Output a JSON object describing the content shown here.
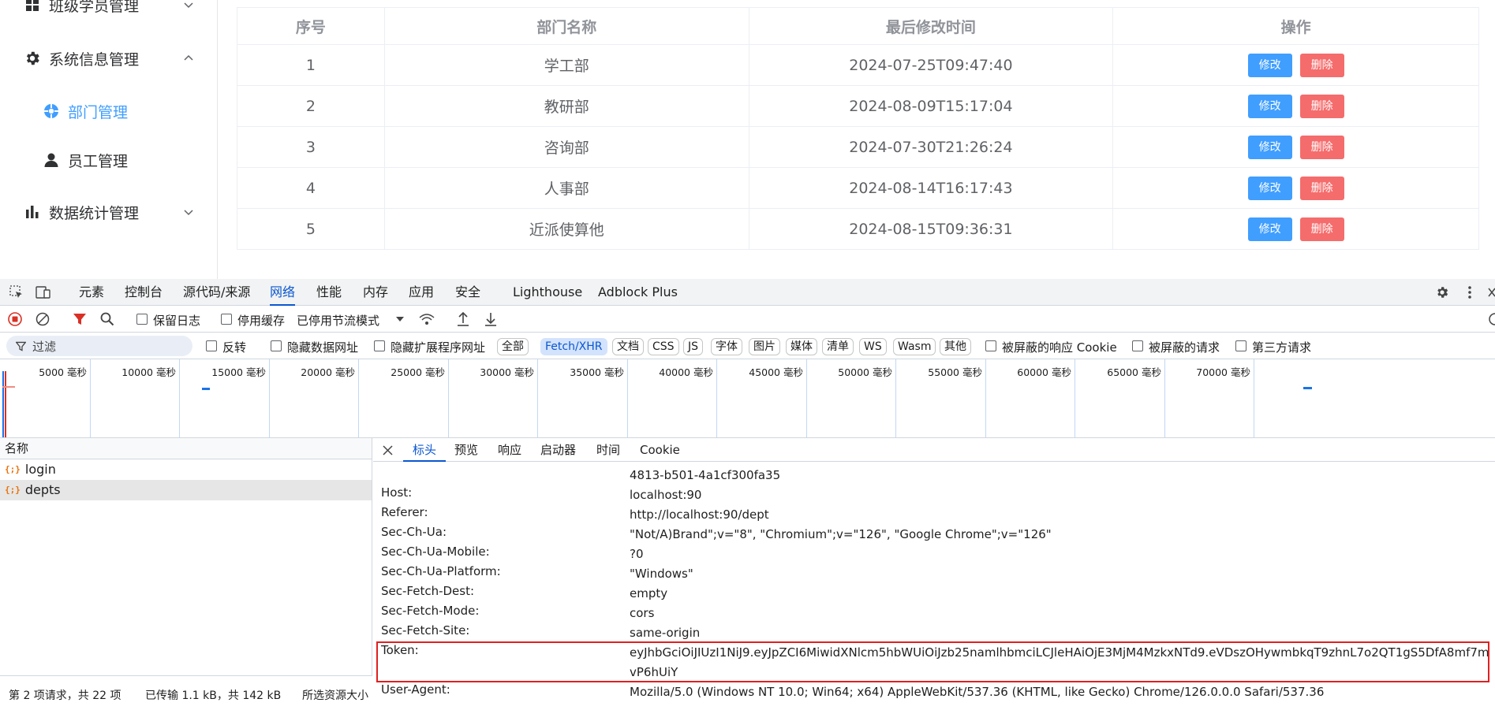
{
  "sidebar": {
    "items": [
      {
        "label": "班级学员管理",
        "icon": "grid-icon"
      },
      {
        "label": "系统信息管理",
        "icon": "gear-icon"
      },
      {
        "label": "部门管理",
        "icon": "dept-icon"
      },
      {
        "label": "员工管理",
        "icon": "user-icon"
      },
      {
        "label": "数据统计管理",
        "icon": "bar-chart-icon"
      }
    ]
  },
  "table": {
    "headers": [
      "序号",
      "部门名称",
      "最后修改时间",
      "操作"
    ],
    "rows": [
      {
        "no": "1",
        "name": "学工部",
        "time": "2024-07-25T09:47:40"
      },
      {
        "no": "2",
        "name": "教研部",
        "time": "2024-08-09T15:17:04"
      },
      {
        "no": "3",
        "name": "咨询部",
        "time": "2024-07-30T21:26:24"
      },
      {
        "no": "4",
        "name": "人事部",
        "time": "2024-08-14T16:17:43"
      },
      {
        "no": "5",
        "name": "近派使算他",
        "time": "2024-08-15T09:36:31"
      }
    ],
    "edit_label": "修改",
    "delete_label": "删除"
  },
  "devtools": {
    "tabs": [
      "元素",
      "控制台",
      "源代码/来源",
      "网络",
      "性能",
      "内存",
      "应用",
      "安全",
      "Lighthouse",
      "Adblock Plus"
    ],
    "toolbar": {
      "preserve_log": "保留日志",
      "disable_cache": "停用缓存",
      "throttling": "已停用节流模式"
    },
    "filter": {
      "placeholder": "过滤",
      "invert": "反转",
      "hide_data_urls": "隐藏数据网址",
      "hide_ext_urls": "隐藏扩展程序网址",
      "types": [
        "全部",
        "Fetch/XHR",
        "文档",
        "CSS",
        "JS",
        "字体",
        "图片",
        "媒体",
        "清单",
        "WS",
        "Wasm",
        "其他"
      ],
      "blocked_cookies": "被屏蔽的响应 Cookie",
      "blocked_requests": "被屏蔽的请求",
      "third_party": "第三方请求"
    },
    "timeline_ticks": [
      "5000 毫秒",
      "10000 毫秒",
      "15000 毫秒",
      "20000 毫秒",
      "25000 毫秒",
      "30000 毫秒",
      "35000 毫秒",
      "40000 毫秒",
      "45000 毫秒",
      "50000 毫秒",
      "55000 毫秒",
      "60000 毫秒",
      "65000 毫秒",
      "70000 毫秒"
    ],
    "request_list": {
      "header": "名称",
      "requests": [
        "login",
        "depts"
      ]
    },
    "status": {
      "requests": "第 2 项请求，共 22 项",
      "transferred": "已传输 1.1 kB，共 142 kB",
      "resources": "所选资源大小"
    },
    "detail_tabs": [
      "标头",
      "预览",
      "响应",
      "启动器",
      "时间",
      "Cookie"
    ],
    "headers": [
      {
        "name": "",
        "value": "4813-b501-4a1cf300fa35"
      },
      {
        "name": "Host:",
        "value": "localhost:90"
      },
      {
        "name": "Referer:",
        "value": "http://localhost:90/dept"
      },
      {
        "name": "Sec-Ch-Ua:",
        "value": "\"Not/A)Brand\";v=\"8\", \"Chromium\";v=\"126\", \"Google Chrome\";v=\"126\""
      },
      {
        "name": "Sec-Ch-Ua-Mobile:",
        "value": "?0"
      },
      {
        "name": "Sec-Ch-Ua-Platform:",
        "value": "\"Windows\""
      },
      {
        "name": "Sec-Fetch-Dest:",
        "value": "empty"
      },
      {
        "name": "Sec-Fetch-Mode:",
        "value": "cors"
      },
      {
        "name": "Sec-Fetch-Site:",
        "value": "same-origin"
      },
      {
        "name": "Token:",
        "value": "eyJhbGciOiJIUzI1NiJ9.eyJpZCI6MiwidXNlcm5hbWUiOiJzb25namlhbmciLCJleHAiOjE3MjM4MzkxNTd9.eVDszOHywmbkqT9zhnL7o2QT1gS5DfA8mf7mvP6hUiY"
      },
      {
        "name": "User-Agent:",
        "value": "Mozilla/5.0 (Windows NT 10.0; Win64; x64) AppleWebKit/537.36 (KHTML, like Gecko) Chrome/126.0.0.0 Safari/537.36"
      }
    ]
  }
}
